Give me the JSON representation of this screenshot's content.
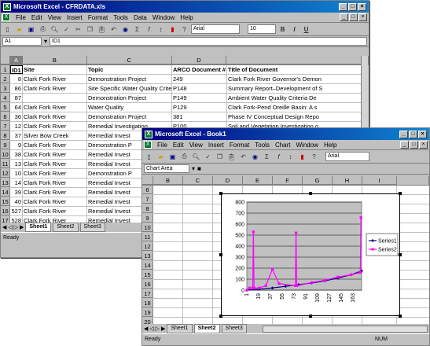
{
  "win1": {
    "title": "Microsoft Excel - CFRDATA.xls",
    "controls": [
      "_",
      "□",
      "×"
    ],
    "doc_controls": [
      "_",
      "□",
      "×"
    ],
    "menu": [
      "File",
      "Edit",
      "View",
      "Insert",
      "Format",
      "Tools",
      "Data",
      "Window",
      "Help"
    ],
    "font": "Arial",
    "size": "10",
    "bold": "B",
    "italic": "I",
    "underline": "U",
    "namebox": "A1",
    "formula": "ID1",
    "cols": [
      "A",
      "B",
      "C",
      "D"
    ],
    "headers": [
      "ID1",
      "Site",
      "Topic",
      "ARCO Document #",
      "Title of Document"
    ],
    "rows": [
      [
        "1",
        "",
        "",
        "",
        ""
      ],
      [
        "2",
        "8",
        "Clark Fork River",
        "Demonstration Project",
        "249",
        "Clark Fork River Governor's Demon"
      ],
      [
        "3",
        "86",
        "Clark Fork River",
        "Site Specific Water Quality Criteria",
        "P148",
        "Summary Report–Development of S"
      ],
      [
        "4",
        "87",
        "",
        "Demonstration Project",
        "P149",
        "Ambient Water Quality Criteria De"
      ],
      [
        "5",
        "64",
        "Clark Fork River",
        "Water Quality",
        "P129",
        "Clark Fork-Pend Oreille Basin: A s"
      ],
      [
        "6",
        "36",
        "Clark Fork River",
        "Demonstration Project",
        "381",
        "Phase IV Conceptual Design Repo"
      ],
      [
        "7",
        "12",
        "Clark Fork River",
        "Remedial Investigation",
        "P100",
        "Soil and Vegetation Investigation o"
      ],
      [
        "8",
        "37",
        "Silver Bow Creek",
        "Remedial Invest",
        "",
        ""
      ],
      [
        "9",
        "9",
        "Clark Fork River",
        "Demonstration P",
        "",
        ""
      ],
      [
        "10",
        "38",
        "Clark Fork River",
        "Remedial Invest",
        "",
        ""
      ],
      [
        "11",
        "13",
        "Clark Fork River",
        "Remedial Invest",
        "",
        ""
      ],
      [
        "12",
        "10",
        "Clark Fork River",
        "Demonstration P",
        "",
        ""
      ],
      [
        "13",
        "14",
        "Clark Fork River",
        "Remedial Invest",
        "",
        ""
      ],
      [
        "14",
        "39",
        "Clark Fork River",
        "Remedial Invest",
        "",
        ""
      ],
      [
        "15",
        "40",
        "Clark Fork River",
        "Remedial Invest",
        "",
        ""
      ],
      [
        "16",
        "527",
        "Clark Fork River",
        "Remedial Invest",
        "",
        ""
      ],
      [
        "17",
        "528",
        "Clark Fork River",
        "Remedial Invest",
        "",
        ""
      ]
    ],
    "tabs": [
      "Sheet1",
      "Sheet2",
      "Sheet3"
    ],
    "status": "Ready"
  },
  "win2": {
    "title": "Microsoft Excel - Book1",
    "controls": [
      "_",
      "□",
      "×"
    ],
    "doc_controls": [
      "_",
      "□",
      "×"
    ],
    "menu": [
      "File",
      "Edit",
      "View",
      "Insert",
      "Format",
      "Tools",
      "Chart",
      "Window",
      "Help"
    ],
    "font": "Arial",
    "namebox": "Chart Area",
    "cols": [
      "B",
      "C",
      "D",
      "E",
      "F",
      "G",
      "H",
      "I"
    ],
    "rows": [
      "6",
      "7",
      "8",
      "9",
      "10",
      "11",
      "12",
      "13",
      "14",
      "15",
      "16",
      "17",
      "18",
      "19",
      "20",
      "21"
    ],
    "tabs": [
      "Sheet1",
      "Sheet2",
      "Sheet3"
    ],
    "status": "Ready",
    "num": "NUM"
  },
  "chart_data": {
    "type": "line",
    "title": "",
    "xlabel": "",
    "ylabel": "",
    "ylim": [
      0,
      800
    ],
    "yticks": [
      "0",
      "100",
      "200",
      "300",
      "400",
      "500",
      "600",
      "700",
      "800"
    ],
    "xticks": [
      "1",
      "19",
      "37",
      "55",
      "73",
      "91",
      "109",
      "127",
      "145",
      "163"
    ],
    "grid": true,
    "legend": "right",
    "series": [
      {
        "name": "Series1",
        "color": "#000080",
        "x": [
          1,
          20,
          40,
          60,
          80,
          100,
          120,
          140,
          160,
          176
        ],
        "y": [
          0,
          10,
          20,
          35,
          50,
          65,
          85,
          110,
          140,
          175
        ]
      },
      {
        "name": "Series2",
        "color": "#ff00ff",
        "x": [
          1,
          5,
          10,
          11,
          12,
          20,
          30,
          40,
          50,
          75,
          76,
          77,
          100,
          120,
          140,
          160,
          174,
          175
        ],
        "y": [
          0,
          20,
          20,
          530,
          20,
          20,
          40,
          190,
          60,
          40,
          520,
          40,
          70,
          90,
          120,
          140,
          160,
          660
        ]
      }
    ]
  }
}
